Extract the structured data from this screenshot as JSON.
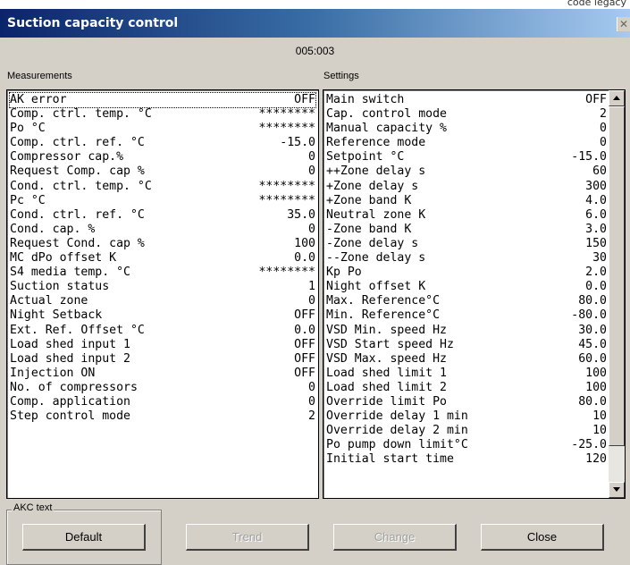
{
  "top_text": "code legacy",
  "window": {
    "title": "Suction capacity control",
    "address": "005:003"
  },
  "measurements": {
    "label": "Measurements",
    "rows": [
      {
        "name": "AK error",
        "value": "OFF"
      },
      {
        "name": "Comp. ctrl. temp. °C",
        "value": "********"
      },
      {
        "name": "Po °C",
        "value": "********"
      },
      {
        "name": "Comp. ctrl. ref. °C",
        "value": "-15.0"
      },
      {
        "name": "Compressor cap.%",
        "value": "0"
      },
      {
        "name": "Request Comp. cap %",
        "value": "0"
      },
      {
        "name": "Cond. ctrl. temp. °C",
        "value": "********"
      },
      {
        "name": "Pc °C",
        "value": "********"
      },
      {
        "name": "Cond. ctrl. ref. °C",
        "value": "35.0"
      },
      {
        "name": "Cond. cap. %",
        "value": "0"
      },
      {
        "name": "Request Cond. cap %",
        "value": "100"
      },
      {
        "name": "MC dPo offset K",
        "value": "0.0"
      },
      {
        "name": "S4 media temp. °C",
        "value": "********"
      },
      {
        "name": "Suction status",
        "value": "1"
      },
      {
        "name": "Actual zone",
        "value": "0"
      },
      {
        "name": "Night Setback",
        "value": "OFF"
      },
      {
        "name": "Ext. Ref. Offset °C",
        "value": "0.0"
      },
      {
        "name": "Load shed input 1",
        "value": "OFF"
      },
      {
        "name": "Load shed input 2",
        "value": "OFF"
      },
      {
        "name": "Injection ON",
        "value": "OFF"
      },
      {
        "name": "No. of compressors",
        "value": "0"
      },
      {
        "name": "Comp. application",
        "value": "0"
      },
      {
        "name": "Step control mode",
        "value": "2"
      }
    ]
  },
  "settings": {
    "label": "Settings",
    "rows": [
      {
        "name": "Main switch",
        "value": "OFF"
      },
      {
        "name": "Cap. control mode",
        "value": "2"
      },
      {
        "name": "Manual capacity %",
        "value": "0"
      },
      {
        "name": "Reference mode",
        "value": "0"
      },
      {
        "name": "Setpoint °C",
        "value": "-15.0"
      },
      {
        "name": "++Zone delay s",
        "value": "60"
      },
      {
        "name": "+Zone delay s",
        "value": "300"
      },
      {
        "name": "+Zone band K",
        "value": "4.0"
      },
      {
        "name": "Neutral zone K",
        "value": "6.0"
      },
      {
        "name": "-Zone band K",
        "value": "3.0"
      },
      {
        "name": "-Zone delay s",
        "value": "150"
      },
      {
        "name": "--Zone delay s",
        "value": "30"
      },
      {
        "name": "Kp Po",
        "value": "2.0"
      },
      {
        "name": "Night offset K",
        "value": "0.0"
      },
      {
        "name": "Max. Reference°C",
        "value": "80.0"
      },
      {
        "name": "Min. Reference°C",
        "value": "-80.0"
      },
      {
        "name": "VSD Min. speed Hz",
        "value": "30.0"
      },
      {
        "name": "VSD Start speed Hz",
        "value": "45.0"
      },
      {
        "name": "VSD Max. speed Hz",
        "value": "60.0"
      },
      {
        "name": "Load shed limit 1",
        "value": "100"
      },
      {
        "name": "Load shed limit 2",
        "value": "100"
      },
      {
        "name": "Override limit Po",
        "value": "80.0"
      },
      {
        "name": "Override delay 1 min",
        "value": "10"
      },
      {
        "name": "Override delay 2 min",
        "value": "10"
      },
      {
        "name": "Po pump down limit°C",
        "value": "-25.0"
      },
      {
        "name": "Initial start time",
        "value": "120"
      }
    ]
  },
  "akc_text": {
    "label": "AKC text"
  },
  "buttons": {
    "default": "Default",
    "trend": "Trend",
    "change": "Change",
    "close": "Close"
  }
}
